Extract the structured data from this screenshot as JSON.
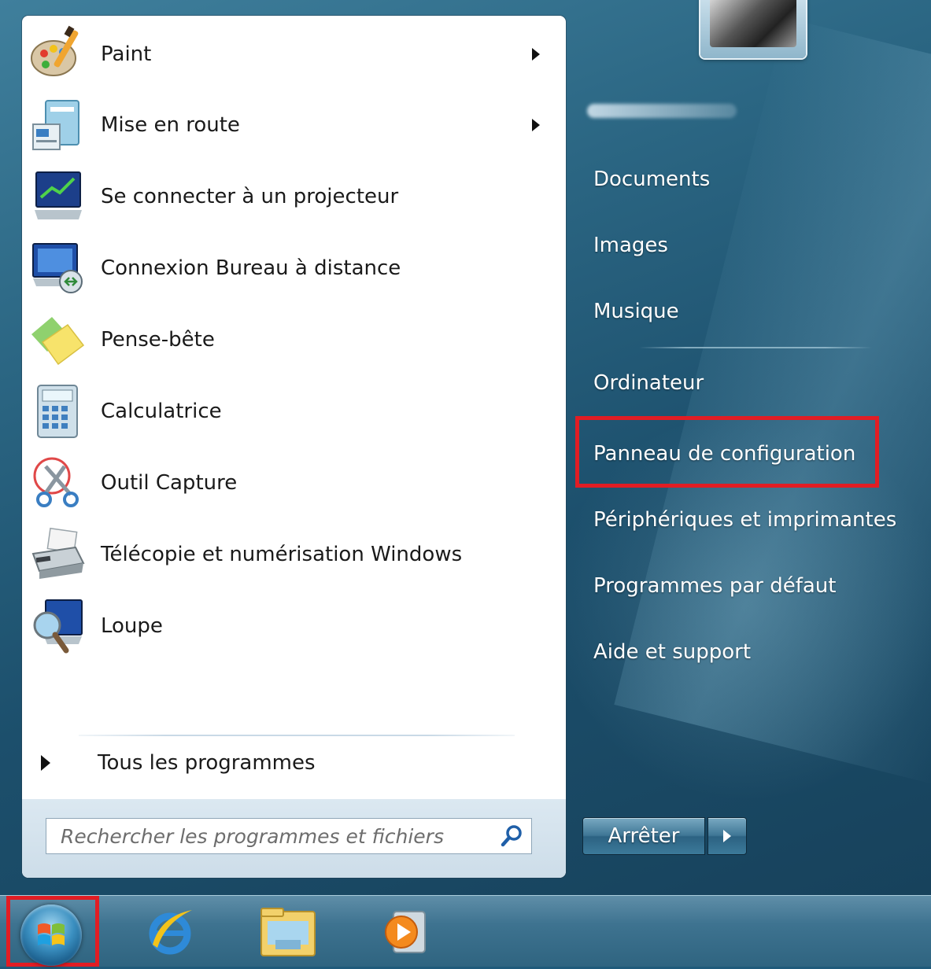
{
  "programs": [
    {
      "label": "Paint",
      "icon": "paint-icon",
      "has_submenu": true
    },
    {
      "label": "Mise en route",
      "icon": "getting-started-icon",
      "has_submenu": true
    },
    {
      "label": "Se connecter à un projecteur",
      "icon": "projector-icon",
      "has_submenu": false
    },
    {
      "label": "Connexion Bureau à distance",
      "icon": "remote-desktop-icon",
      "has_submenu": false
    },
    {
      "label": "Pense-bête",
      "icon": "sticky-notes-icon",
      "has_submenu": false
    },
    {
      "label": "Calculatrice",
      "icon": "calculator-icon",
      "has_submenu": false
    },
    {
      "label": "Outil Capture",
      "icon": "snipping-tool-icon",
      "has_submenu": false
    },
    {
      "label": "Télécopie et numérisation Windows",
      "icon": "fax-scan-icon",
      "has_submenu": false
    },
    {
      "label": "Loupe",
      "icon": "magnifier-icon",
      "has_submenu": false
    }
  ],
  "all_programs": {
    "label": "Tous les programmes"
  },
  "search": {
    "placeholder": "Rechercher les programmes et fichiers"
  },
  "right_panel": {
    "items": [
      {
        "label": "Documents"
      },
      {
        "label": "Images"
      },
      {
        "label": "Musique"
      },
      {
        "label": "Ordinateur"
      },
      {
        "label": "Panneau de configuration",
        "highlighted": true
      },
      {
        "label": "Périphériques et imprimantes"
      },
      {
        "label": "Programmes par défaut"
      },
      {
        "label": "Aide et support"
      }
    ]
  },
  "shutdown": {
    "label": "Arrêter"
  },
  "taskbar": {
    "items": [
      "start-orb-icon",
      "internet-explorer-icon",
      "file-explorer-icon",
      "media-player-icon"
    ]
  },
  "colors": {
    "highlight": "#e11d24",
    "menu_blue": "#2b6683",
    "text_white": "#ffffff"
  }
}
